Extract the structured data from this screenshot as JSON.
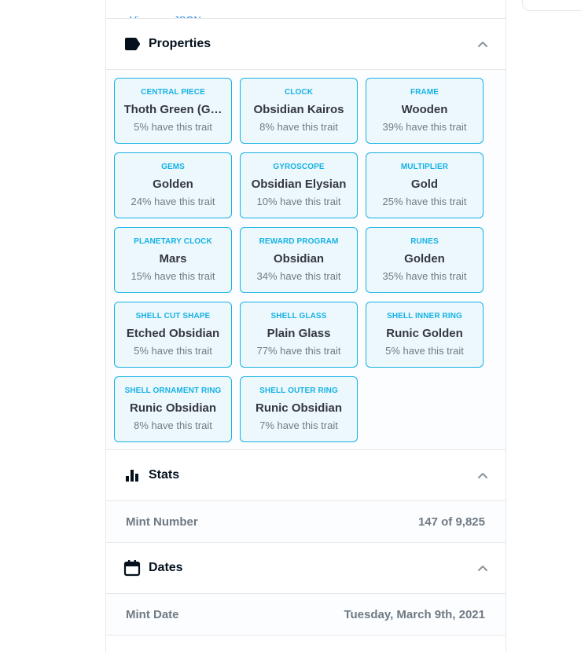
{
  "top_cutoff_link": "View raw JSON",
  "properties": {
    "title": "Properties",
    "icon": "label-tag-icon",
    "collapse_icon": "chevron-up-icon",
    "traits": [
      {
        "type": "Central Piece",
        "value": "Thoth Green (G…",
        "rarity": "5% have this trait"
      },
      {
        "type": "Clock",
        "value": "Obsidian Kairos",
        "rarity": "8% have this trait"
      },
      {
        "type": "Frame",
        "value": "Wooden",
        "rarity": "39% have this trait"
      },
      {
        "type": "Gems",
        "value": "Golden",
        "rarity": "24% have this trait"
      },
      {
        "type": "Gyroscope",
        "value": "Obsidian Elysian",
        "rarity": "10% have this trait"
      },
      {
        "type": "Multiplier",
        "value": "Gold",
        "rarity": "25% have this trait"
      },
      {
        "type": "Planetary Clock",
        "value": "Mars",
        "rarity": "15% have this trait"
      },
      {
        "type": "Reward Program",
        "value": "Obsidian",
        "rarity": "34% have this trait"
      },
      {
        "type": "Runes",
        "value": "Golden",
        "rarity": "35% have this trait"
      },
      {
        "type": "Shell Cut Shape",
        "value": "Etched Obsidian",
        "rarity": "5% have this trait"
      },
      {
        "type": "Shell Glass",
        "value": "Plain Glass",
        "rarity": "77% have this trait"
      },
      {
        "type": "Shell Inner Ring",
        "value": "Runic Golden",
        "rarity": "5% have this trait"
      },
      {
        "type": "Shell Ornament Ring",
        "value": "Runic Obsidian",
        "rarity": "8% have this trait"
      },
      {
        "type": "Shell Outer Ring",
        "value": "Runic Obsidian",
        "rarity": "7% have this trait"
      }
    ]
  },
  "stats": {
    "title": "Stats",
    "icon": "bar-chart-icon",
    "collapse_icon": "chevron-up-icon",
    "rows": [
      {
        "label": "Mint Number",
        "value": "147 of 9,825"
      }
    ]
  },
  "dates": {
    "title": "Dates",
    "icon": "calendar-icon",
    "collapse_icon": "chevron-up-icon",
    "rows": [
      {
        "label": "Mint Date",
        "value": "Tuesday, March 9th, 2021"
      }
    ]
  },
  "colors": {
    "accent": "#15b2e5",
    "border": "#e5e8eb",
    "muted_text": "#707a83",
    "link": "#2081e2"
  }
}
